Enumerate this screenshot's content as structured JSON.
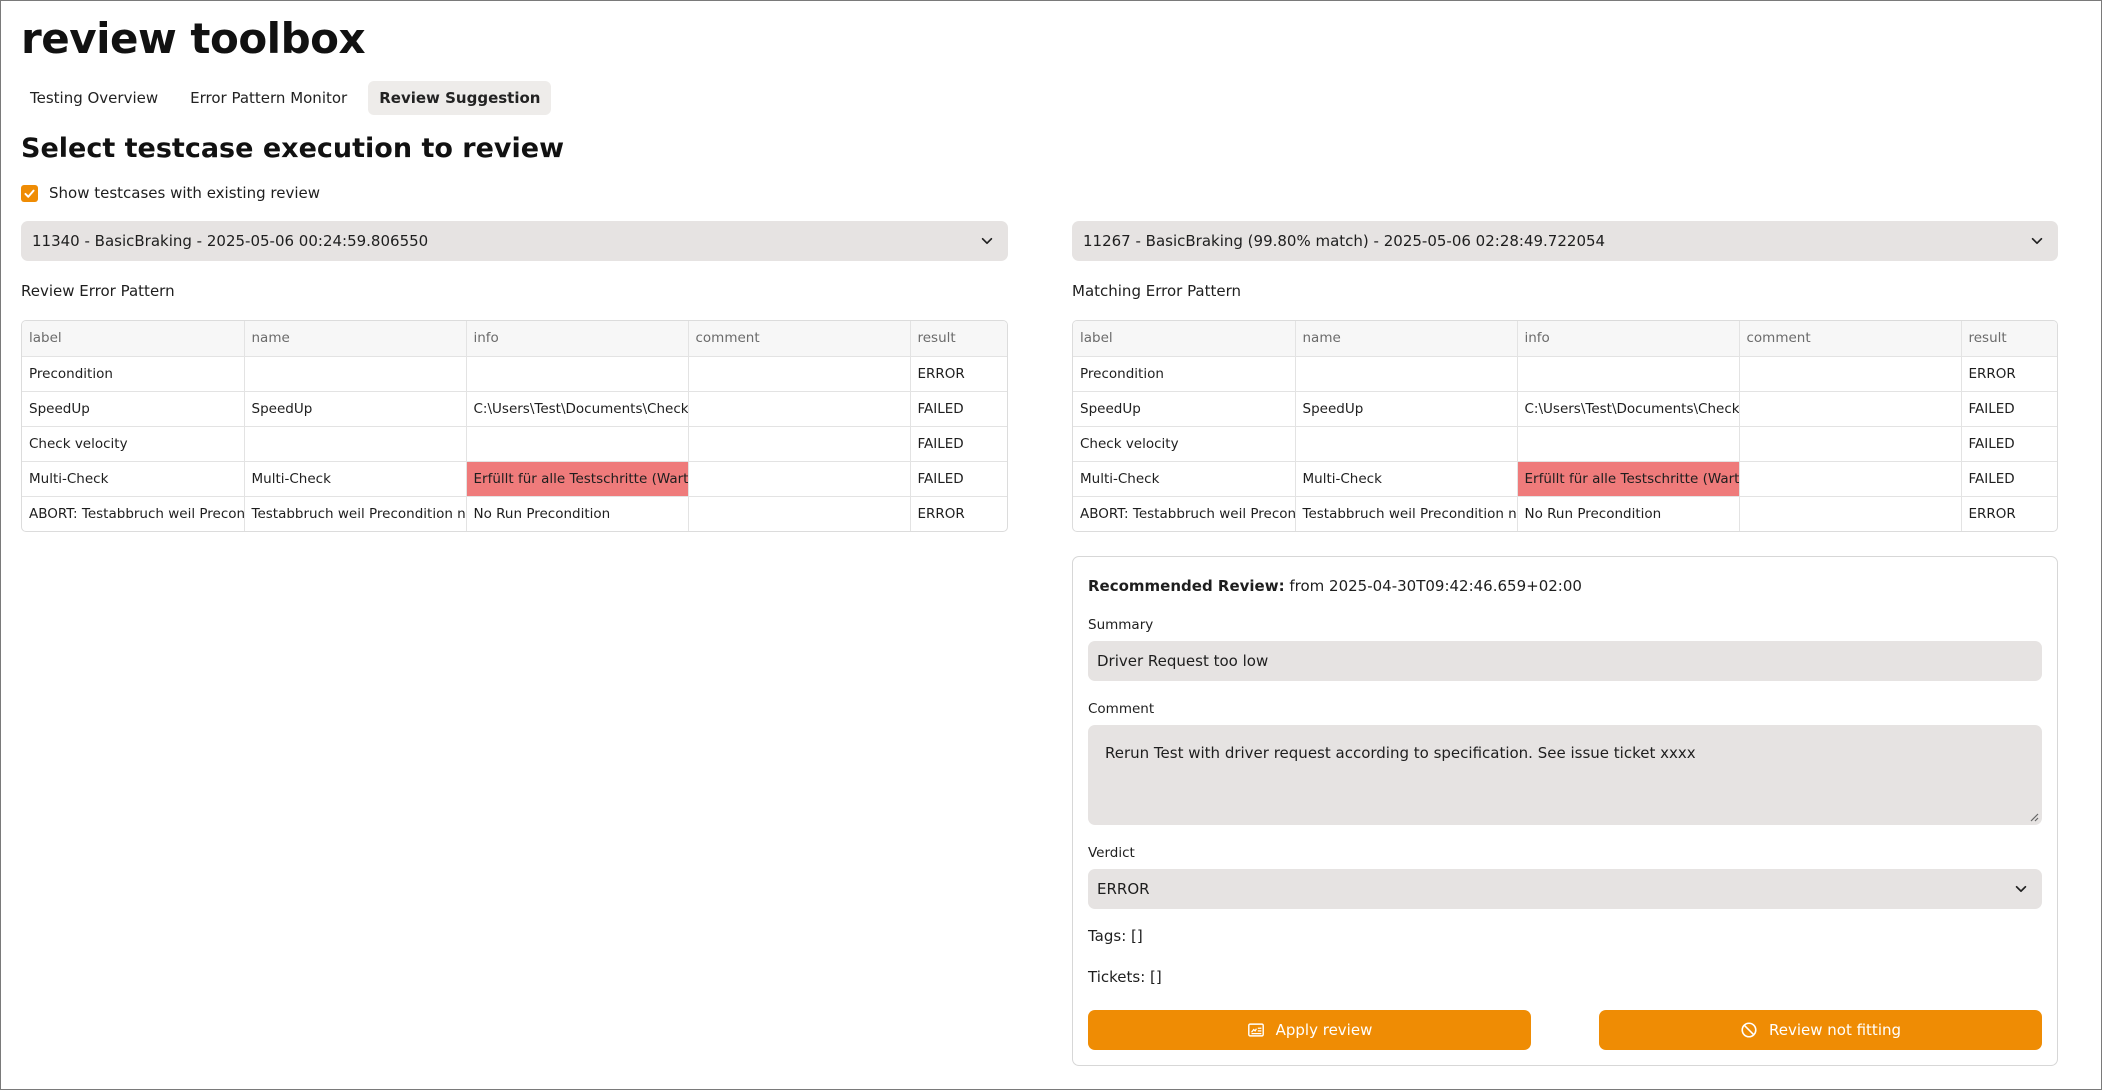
{
  "app": {
    "title": "review toolbox"
  },
  "tabs": [
    {
      "label": "Testing Overview",
      "active": false
    },
    {
      "label": "Error Pattern Monitor",
      "active": false
    },
    {
      "label": "Review Suggestion",
      "active": true
    }
  ],
  "section": {
    "title": "Select testcase execution to review"
  },
  "show_existing": {
    "label": "Show testcases with existing review",
    "checked": true
  },
  "left": {
    "select_value": "11340 - BasicBraking - 2025-05-06 00:24:59.806550",
    "panel_label": "Review Error Pattern",
    "table": {
      "columns": [
        "label",
        "name",
        "info",
        "comment",
        "result"
      ],
      "rows": [
        [
          "Precondition",
          "",
          "",
          "",
          "ERROR"
        ],
        [
          "SpeedUp",
          "SpeedUp",
          "C:\\Users\\Test\\Documents\\Check",
          "",
          "FAILED"
        ],
        [
          "Check velocity",
          "",
          "",
          "",
          "FAILED"
        ],
        [
          "Multi-Check",
          "Multi-Check",
          "Erfüllt für alle Testschritte (Warte bis",
          "",
          "FAILED"
        ],
        [
          "ABORT: Testabbruch weil Precondition",
          "Testabbruch weil Precondition nicht",
          "No Run Precondition",
          "",
          "ERROR"
        ]
      ]
    }
  },
  "right": {
    "select_value": "11267 - BasicBraking (99.80% match) - 2025-05-06 02:28:49.722054",
    "panel_label": "Matching Error Pattern",
    "table": {
      "columns": [
        "label",
        "name",
        "info",
        "comment",
        "result"
      ],
      "rows": [
        [
          "Precondition",
          "",
          "",
          "",
          "ERROR"
        ],
        [
          "SpeedUp",
          "SpeedUp",
          "C:\\Users\\Test\\Documents\\Check",
          "",
          "FAILED"
        ],
        [
          "Check velocity",
          "",
          "",
          "",
          "FAILED"
        ],
        [
          "Multi-Check",
          "Multi-Check",
          "Erfüllt für alle Testschritte (Warte bis",
          "",
          "FAILED"
        ],
        [
          "ABORT: Testabbruch weil Precondition",
          "Testabbruch weil Precondition nicht",
          "No Run Precondition",
          "",
          "ERROR"
        ]
      ]
    }
  },
  "review": {
    "heading_bold": "Recommended Review:",
    "heading_rest": " from 2025-04-30T09:42:46.659+02:00",
    "summary_label": "Summary",
    "summary_value": "Driver Request too low",
    "comment_label": "Comment",
    "comment_value": "Rerun Test with driver request according to specification. See issue ticket xxxx",
    "verdict_label": "Verdict",
    "verdict_value": "ERROR",
    "tags_text": "Tags: []",
    "tickets_text": "Tickets: []",
    "apply_label": "Apply review",
    "not_fitting_label": "Review not fitting"
  },
  "colors": {
    "accent": "#ef8c04",
    "highlight": "#ef7b7b",
    "input_bg": "#e6e3e2"
  },
  "icons": {
    "checkbox": "check-icon",
    "select": "chevron-down-icon",
    "apply": "review-card-icon",
    "not_fitting": "prohibited-icon"
  }
}
